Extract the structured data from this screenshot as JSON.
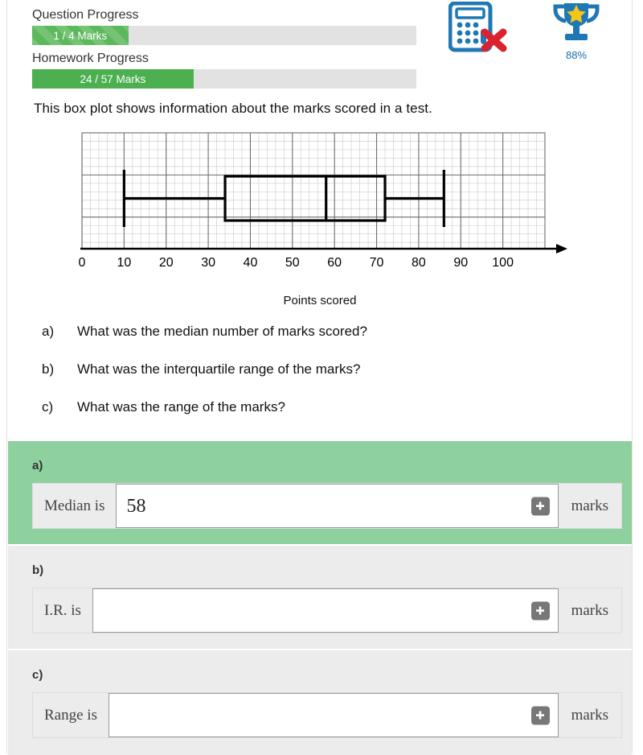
{
  "header": {
    "question_progress": {
      "label": "Question Progress",
      "value_text": "1 / 4 Marks",
      "current": 1,
      "total": 4,
      "percent": 25,
      "color": "#5cb85c"
    },
    "homework_progress": {
      "label": "Homework Progress",
      "value_text": "24 / 57 Marks",
      "current": 24,
      "total": 57,
      "percent": 42,
      "color": "#4caf50"
    },
    "calculator_icon": "calculator-not-allowed-icon",
    "calculator_color": "#1f77b4",
    "cross_color": "#d9232e",
    "trophy_icon": "trophy-icon",
    "trophy_color": "#1f77b4",
    "star_color": "#f5c518",
    "trophy_percent": "88%"
  },
  "question": {
    "stem": "This box plot shows information about the marks scored in a test.",
    "parts": [
      {
        "mark": "a)",
        "text": "What was the median number of marks scored?"
      },
      {
        "mark": "b)",
        "text": "What was the interquartile range of the marks?"
      },
      {
        "mark": "c)",
        "text": "What was the range of the marks?"
      }
    ]
  },
  "chart_data": {
    "type": "box",
    "title": "",
    "xlabel": "Points scored",
    "ylabel": "",
    "xlim": [
      0,
      110
    ],
    "xticks": [
      0,
      10,
      20,
      30,
      40,
      50,
      60,
      70,
      80,
      90,
      100
    ],
    "xtick_labels": [
      "0",
      "10",
      "20",
      "30",
      "40",
      "50",
      "60",
      "70",
      "80",
      "90",
      "100"
    ],
    "grid": true,
    "minor_grid_step": 2,
    "major_grid_step": 10,
    "legend": "none",
    "series": [
      {
        "name": "Marks scored in a test",
        "min": 10,
        "q1": 34,
        "median": 58,
        "q3": 72,
        "max": 86,
        "iqr": 38,
        "range": 76
      }
    ]
  },
  "answers": {
    "parts": [
      {
        "letter": "a)",
        "label": "Median is",
        "value": "58",
        "unit": "marks",
        "add_icon": "plus-icon",
        "state": "correct",
        "background": "#8fd19e"
      },
      {
        "letter": "b)",
        "label": "I.R. is",
        "value": "",
        "unit": "marks",
        "add_icon": "plus-icon",
        "state": "empty",
        "background": "#ececec"
      },
      {
        "letter": "c)",
        "label": "Range is",
        "value": "",
        "unit": "marks",
        "add_icon": "plus-icon",
        "state": "empty",
        "background": "#ececec"
      }
    ]
  }
}
